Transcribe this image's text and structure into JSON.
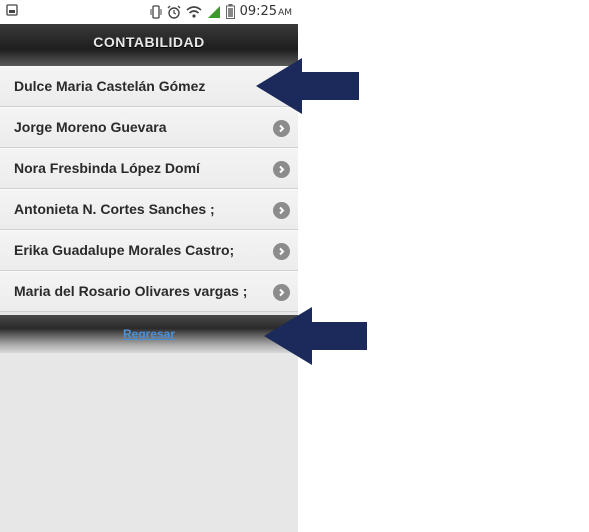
{
  "statusbar": {
    "time": "09:25",
    "ampm": "AM"
  },
  "header": {
    "title": "CONTABILIDAD"
  },
  "contacts": [
    {
      "label": "Dulce Maria Castelán Gómez",
      "has_chevron": false
    },
    {
      "label": "Jorge Moreno Guevara",
      "has_chevron": true
    },
    {
      "label": "Nora Fresbinda López Domí",
      "has_chevron": true
    },
    {
      "label": "Antonieta N. Cortes Sanches ;",
      "has_chevron": true
    },
    {
      "label": "Erika Guadalupe Morales Castro;",
      "has_chevron": true
    },
    {
      "label": "Maria del Rosario Olivares vargas ;",
      "has_chevron": true
    }
  ],
  "footer": {
    "link_label": "Regresar"
  },
  "colors": {
    "arrow": "#1b2a5a",
    "link": "#4a90d9"
  },
  "icons": [
    "sim-card-icon",
    "vibrate-icon",
    "alarm-icon",
    "wifi-icon",
    "signal-icon",
    "battery-icon",
    "chevron-right-icon",
    "arrow-left-icon"
  ]
}
